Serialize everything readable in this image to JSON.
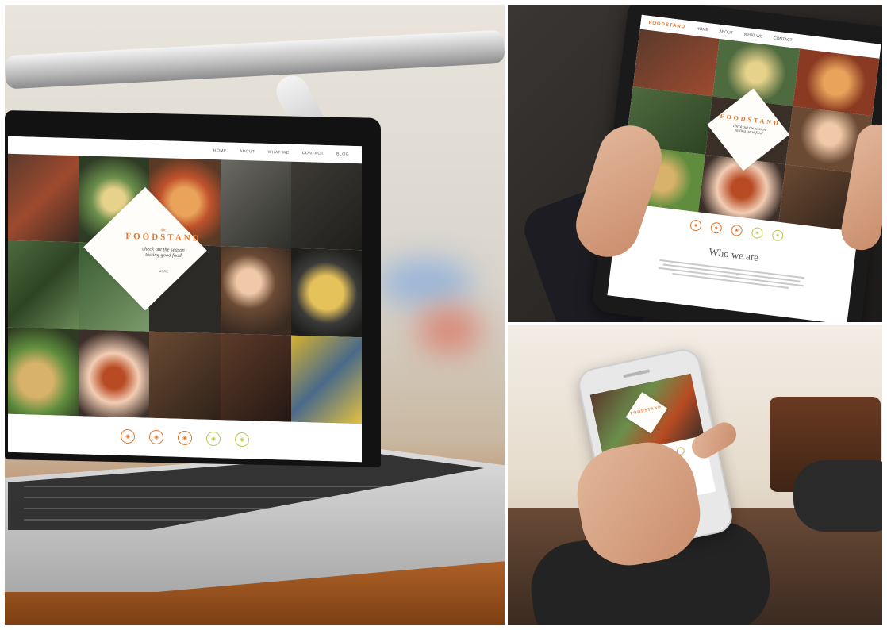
{
  "site": {
    "brand": "FOODSTAND",
    "brand_small": "the",
    "tagline_line1": "check out the season",
    "tagline_line2": "tasting good food",
    "cta": "MORE",
    "nav": [
      "HOME",
      "ABOUT",
      "WHAT WE",
      "CONTACT",
      "BLOG"
    ],
    "who_we_are": "Who we are",
    "feature_icons": [
      "bowl-icon",
      "cup-icon",
      "leaf-icon",
      "basket-icon",
      "pot-icon"
    ]
  },
  "colors": {
    "accent": "#e2772b",
    "accent_green": "#bfc64a",
    "wood_table": "#a45a23",
    "device_dark": "#1a1a1a"
  },
  "scenes": [
    "laptop-scene",
    "tablet-scene",
    "phone-scene"
  ]
}
